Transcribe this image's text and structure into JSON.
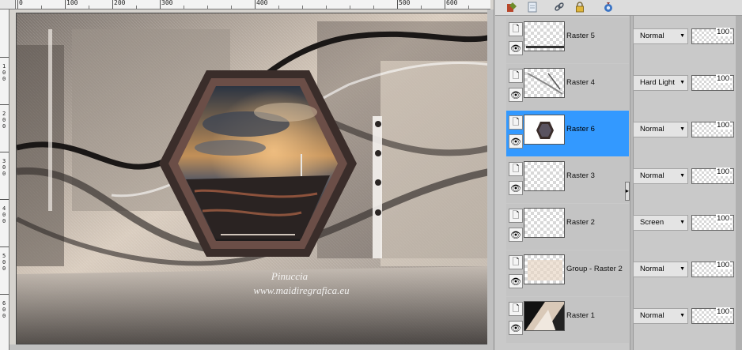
{
  "canvas": {
    "ruler_h_labels": [
      "0",
      "100",
      "200",
      "300",
      "400",
      "500",
      "600"
    ],
    "ruler_v_labels": [
      "1 0 0",
      "2 0 0",
      "3 0 0",
      "4 0 0",
      "5 0 0",
      "6 0 0"
    ],
    "watermark_line1": "Pinuccia",
    "watermark_line2": "www.maidiregrafica.eu"
  },
  "toolbar": {
    "icons": [
      "paint-layer-icon",
      "new-layer-icon",
      "link-icon",
      "lock-icon",
      "mask-icon"
    ]
  },
  "layers": [
    {
      "name": "Raster 5",
      "blend": "Normal",
      "opacity": "100",
      "selected": false
    },
    {
      "name": "Raster 4",
      "blend": "Hard Light",
      "opacity": "100",
      "selected": false
    },
    {
      "name": "Raster 6",
      "blend": "Normal",
      "opacity": "100",
      "selected": true
    },
    {
      "name": "Raster 3",
      "blend": "Normal",
      "opacity": "100",
      "selected": false
    },
    {
      "name": "Raster 2",
      "blend": "Screen",
      "opacity": "100",
      "selected": false
    },
    {
      "name": "Group - Raster 2",
      "blend": "Normal",
      "opacity": "100",
      "selected": false
    },
    {
      "name": "Raster 1",
      "blend": "Normal",
      "opacity": "100",
      "selected": false
    }
  ],
  "colors": {
    "selection": "#3399ff",
    "palette_bg": "#c9c9c9",
    "art_beige": "#d8cbbd",
    "art_dark": "#2e2a28"
  }
}
